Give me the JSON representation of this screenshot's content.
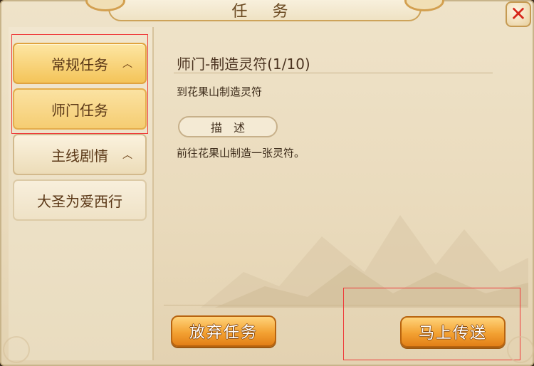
{
  "window": {
    "title": "任 务",
    "close_icon": "close-icon",
    "accent_color": "#f3a233",
    "close_color": "#d6271b"
  },
  "sidebar": {
    "categories": [
      {
        "label": "常规任务",
        "expanded": true,
        "items": [
          {
            "label": "师门任务",
            "selected": true
          }
        ]
      },
      {
        "label": "主线剧情",
        "expanded": true,
        "items": [
          {
            "label": "大圣为爱西行",
            "selected": false
          }
        ]
      }
    ],
    "chevron_icon": "chevron-up-icon"
  },
  "task": {
    "title": "师门-制造灵符(1/10)",
    "target": "到花果山制造灵符",
    "description_header": "描述",
    "description": "前往花果山制造一张灵符。"
  },
  "actions": {
    "abandon_label": "放弃任务",
    "teleport_label": "马上传送"
  }
}
